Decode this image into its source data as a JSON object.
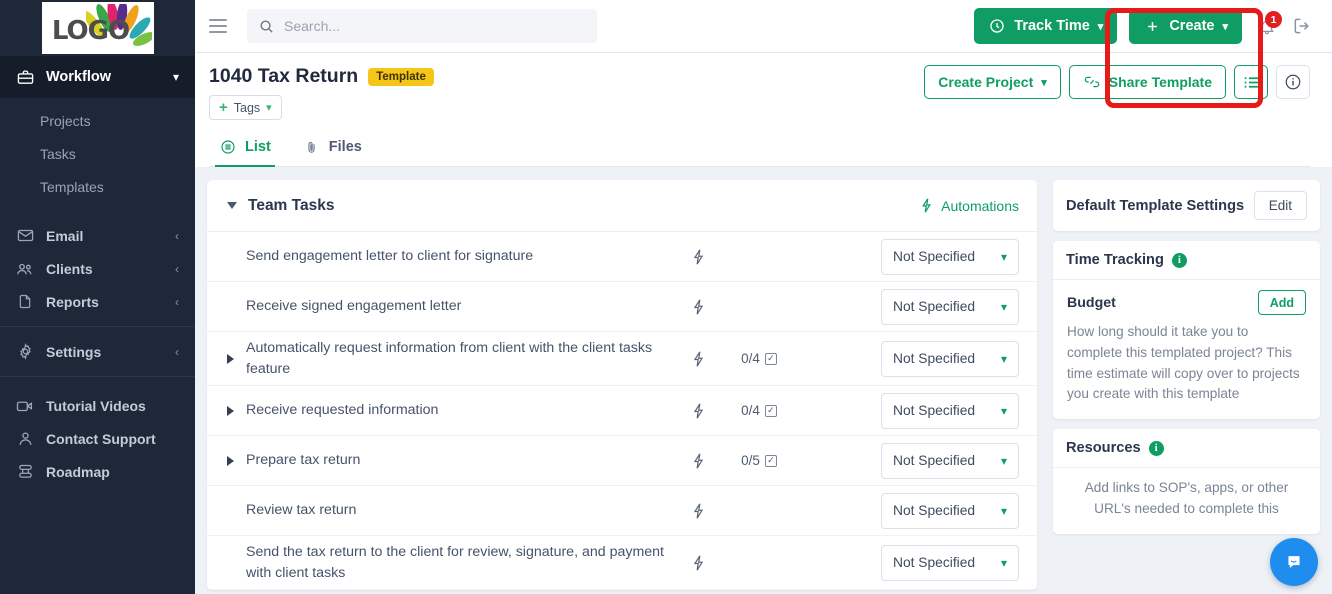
{
  "brand": {
    "logo_text": "LOGO",
    "accent_green": "#0f9d63",
    "sidebar_bg": "#1e2838",
    "badge_yellow": "#f5c518",
    "annotation_red": "#e81919",
    "intercom_blue": "#1f8ded"
  },
  "topbar": {
    "menu_icon": "hamburger-icon",
    "search": {
      "placeholder": "Search...",
      "value": "",
      "icon": "search-icon"
    },
    "track_time_label": "Track Time",
    "track_time_icon": "clock-icon",
    "create_label": "Create",
    "create_icon": "plus-icon",
    "notification_icon": "bell-icon",
    "notification_count": "1",
    "logout_icon": "logout-icon"
  },
  "sidebar": {
    "active_item": {
      "label": "Workflow",
      "icon": "briefcase-icon",
      "chevron": "chevron-down-icon"
    },
    "sub_items": [
      {
        "label": "Projects"
      },
      {
        "label": "Tasks"
      },
      {
        "label": "Templates"
      }
    ],
    "groups": [
      {
        "items": [
          {
            "label": "Email",
            "icon": "mail-icon",
            "chevron": "chevron-left-icon"
          },
          {
            "label": "Clients",
            "icon": "users-icon",
            "chevron": "chevron-left-icon"
          },
          {
            "label": "Reports",
            "icon": "document-icon",
            "chevron": "chevron-left-icon"
          }
        ]
      },
      {
        "items": [
          {
            "label": "Settings",
            "icon": "gear-icon",
            "chevron": "chevron-left-icon"
          }
        ]
      },
      {
        "items": [
          {
            "label": "Tutorial Videos",
            "icon": "video-camera-icon",
            "chevron": ""
          },
          {
            "label": "Contact Support",
            "icon": "person-icon",
            "chevron": ""
          },
          {
            "label": "Roadmap",
            "icon": "roadmap-icon",
            "chevron": ""
          }
        ]
      }
    ]
  },
  "page_header": {
    "title": "1040 Tax Return",
    "badge": "Template",
    "tags_button": {
      "label": "Tags",
      "plus": "+",
      "chevron": "chevron-down-icon"
    },
    "actions": {
      "create_project_label": "Create Project",
      "create_project_chevron": "chevron-down-icon",
      "share_template_label": "Share Template",
      "share_template_icon": "link-icon",
      "list_view_icon": "list-view-icon",
      "info_icon": "info-circle-icon"
    },
    "tabs": [
      {
        "label": "List",
        "icon": "list-icon",
        "active": true
      },
      {
        "label": "Files",
        "icon": "paperclip-icon",
        "active": false
      }
    ]
  },
  "tasks_panel": {
    "group_title": "Team Tasks",
    "collapse_icon": "triangle-down-icon",
    "automations_label": "Automations",
    "automations_icon": "bolt-icon",
    "status_chevron": "chevron-down-icon",
    "rows": [
      {
        "name": "Send engagement letter to client for signature",
        "expandable": false,
        "bolt": "bolt-icon",
        "subtasks": "",
        "status": "Not Specified"
      },
      {
        "name": "Receive signed engagement letter",
        "expandable": false,
        "bolt": "bolt-icon",
        "subtasks": "",
        "status": "Not Specified"
      },
      {
        "name": "Automatically request information from client with the client tasks feature",
        "expandable": true,
        "bolt": "bolt-icon",
        "subtasks": "0/4",
        "status": "Not Specified"
      },
      {
        "name": "Receive requested information",
        "expandable": true,
        "bolt": "bolt-icon",
        "subtasks": "0/4",
        "status": "Not Specified"
      },
      {
        "name": "Prepare tax return",
        "expandable": true,
        "bolt": "bolt-icon",
        "subtasks": "0/5",
        "status": "Not Specified"
      },
      {
        "name": "Review tax return",
        "expandable": false,
        "bolt": "bolt-icon",
        "subtasks": "",
        "status": "Not Specified"
      },
      {
        "name": "Send the tax return to the client for review, signature, and payment with client tasks",
        "expandable": false,
        "bolt": "bolt-icon",
        "subtasks": "",
        "status": "Not Specified"
      }
    ]
  },
  "right_panel": {
    "settings_card": {
      "title": "Default Template Settings",
      "edit_label": "Edit"
    },
    "time_tracking_card": {
      "title": "Time Tracking",
      "info_icon": "info-circle-icon",
      "budget_title": "Budget",
      "add_label": "Add",
      "description": "How long should it take you to complete this templated project? This time estimate will copy over to projects you create with this template"
    },
    "resources_card": {
      "title": "Resources",
      "info_icon": "info-circle-icon",
      "description": "Add links to SOP's, apps, or other URL's needed to complete this"
    }
  },
  "overlays": {
    "annotation_target": "share-template-button",
    "intercom_icon": "chat-bubble-icon"
  }
}
